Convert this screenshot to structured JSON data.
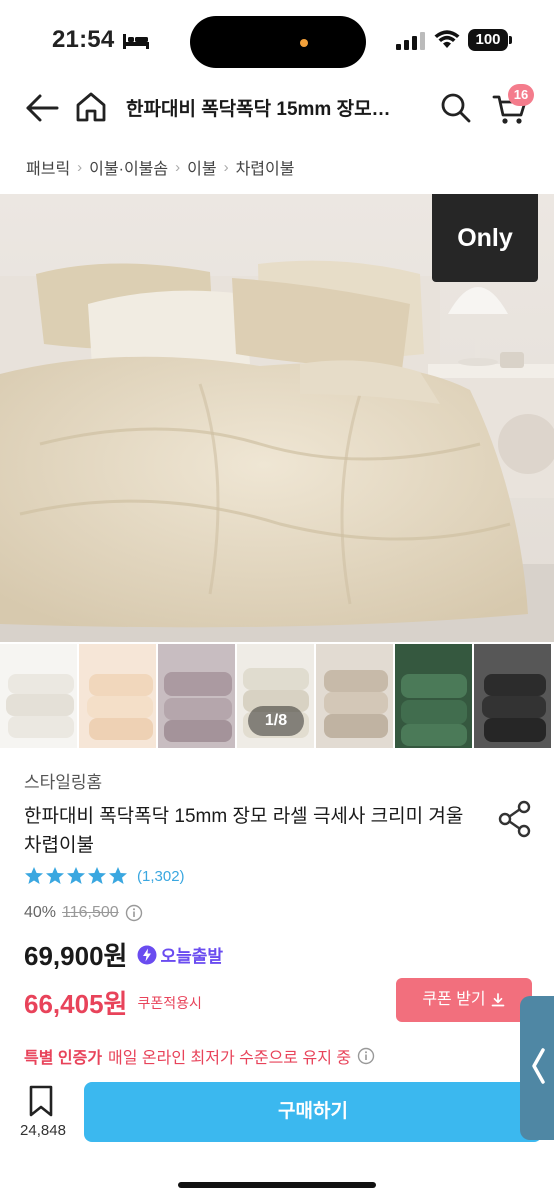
{
  "status_bar": {
    "time": "21:54",
    "battery": "100"
  },
  "header": {
    "title": "한파대비 폭닥폭닥 15mm 장모…",
    "cart_count": "16"
  },
  "breadcrumb": [
    "패브릭",
    "이불·이불솜",
    "이불",
    "차렵이불"
  ],
  "hero": {
    "badge": "Only",
    "thumb_counter": "1/8"
  },
  "thumbnails": [
    {
      "color": "#f2f0ec"
    },
    {
      "color": "#f1ddc9"
    },
    {
      "color": "#b8a9b0"
    },
    {
      "color": "#e8e4da"
    },
    {
      "color": "#cfc3b4"
    },
    {
      "color": "#3f6a4c"
    },
    {
      "color": "#3a3a3a"
    }
  ],
  "product": {
    "brand": "스타일링홈",
    "title": "한파대비 폭닥폭닥 15mm 장모 라셀 극세사 크리미 겨울 차렵이불",
    "review_count": "(1,302)",
    "discount": "40%",
    "original_price": "116,500",
    "price": "69,900원",
    "delivery_badge": "오늘출발",
    "coupon_price": "66,405원",
    "coupon_note": "쿠폰적용시",
    "coupon_button": "쿠폰 받기",
    "cert_label": "특별 인증가",
    "cert_text": "매일 온라인 최저가 수준으로 유지 중"
  },
  "bottom_bar": {
    "bookmark_count": "24,848",
    "buy_label": "구매하기"
  },
  "colors": {
    "accent_blue": "#3bb8ef",
    "coupon_red": "#e8435a",
    "star_blue": "#3aa7e0",
    "delivery_purple": "#6a4cf0"
  }
}
